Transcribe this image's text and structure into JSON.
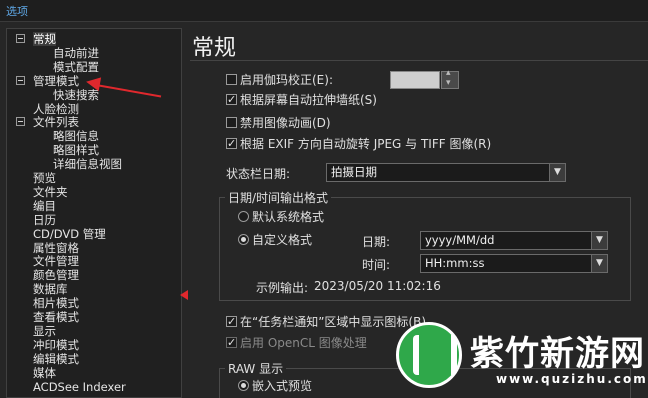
{
  "window": {
    "title": "选项"
  },
  "tree": {
    "items": [
      {
        "label": "常规",
        "level": 0,
        "expander": true,
        "selected": true
      },
      {
        "label": "自动前进",
        "level": 2
      },
      {
        "label": "模式配置",
        "level": 2
      },
      {
        "label": "管理模式",
        "level": 0,
        "expander": true
      },
      {
        "label": "快速搜索",
        "level": 2
      },
      {
        "label": "人脸检测",
        "level": 0
      },
      {
        "label": "文件列表",
        "level": 0,
        "expander": true
      },
      {
        "label": "略图信息",
        "level": 2
      },
      {
        "label": "略图样式",
        "level": 2
      },
      {
        "label": "详细信息视图",
        "level": 2
      },
      {
        "label": "预览",
        "level": 0
      },
      {
        "label": "文件夹",
        "level": 0
      },
      {
        "label": "编目",
        "level": 0
      },
      {
        "label": "日历",
        "level": 0
      },
      {
        "label": "CD/DVD 管理",
        "level": 0
      },
      {
        "label": "属性窗格",
        "level": 0
      },
      {
        "label": "文件管理",
        "level": 0
      },
      {
        "label": "颜色管理",
        "level": 0
      },
      {
        "label": "数据库",
        "level": 0
      },
      {
        "label": "相片模式",
        "level": 0
      },
      {
        "label": "查看模式",
        "level": 0
      },
      {
        "label": "显示",
        "level": 0
      },
      {
        "label": "冲印模式",
        "level": 0
      },
      {
        "label": "编辑模式",
        "level": 0
      },
      {
        "label": "媒体",
        "level": 0
      },
      {
        "label": "ACDSee Indexer",
        "level": 0
      }
    ]
  },
  "main": {
    "title": "常规",
    "gamma": {
      "label": "启用伽玛校正(E):",
      "checked": false,
      "value": ""
    },
    "stretch_wallpaper": {
      "label": "根据屏幕自动拉伸墙纸(S)",
      "checked": true
    },
    "disable_animation": {
      "label": "禁用图像动画(D)",
      "checked": false
    },
    "exif_rotate": {
      "label": "根据 EXIF 方向自动旋转 JPEG 与 TIFF 图像(R)",
      "checked": true
    },
    "statusbar_date": {
      "label": "状态栏日期:",
      "value": "拍摄日期"
    },
    "datetime_group": {
      "title": "日期/时间输出格式",
      "system_format": {
        "label": "默认系统格式",
        "selected": false
      },
      "custom_format": {
        "label": "自定义格式",
        "selected": true
      },
      "date_label": "日期:",
      "date_value": "yyyy/MM/dd",
      "time_label": "时间:",
      "time_value": "HH:mm:ss",
      "sample_label": "示例输出:",
      "sample_value": "2023/05/20 11:02:16"
    },
    "taskbar_icon": {
      "label": "在“任务栏通知”区域中显示图标(B)",
      "checked": true
    },
    "opencl": {
      "label": "启用 OpenCL 图像处理",
      "checked": true,
      "disabled": true
    },
    "raw_group": {
      "title": "RAW 显示",
      "embedded_preview": {
        "label": "嵌入式预览",
        "selected": true
      }
    }
  },
  "watermark": {
    "name": "紫竹新游网",
    "url": "www.quzizhu.com"
  },
  "colors": {
    "accent": "#5fa8e6",
    "annotation": "#e0282d",
    "logo": "#2fa84a"
  }
}
